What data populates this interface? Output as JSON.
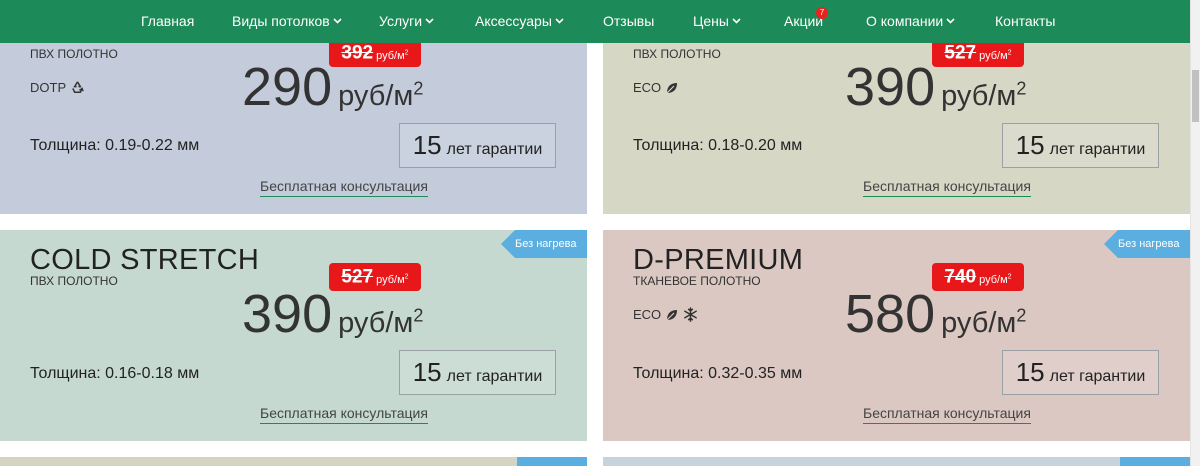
{
  "nav": {
    "items": [
      {
        "label": "Главная",
        "has_dropdown": false
      },
      {
        "label": "Виды потолков",
        "has_dropdown": true
      },
      {
        "label": "Услуги",
        "has_dropdown": true
      },
      {
        "label": "Аксессуары",
        "has_dropdown": true
      },
      {
        "label": "Отзывы",
        "has_dropdown": false
      },
      {
        "label": "Цены",
        "has_dropdown": true
      },
      {
        "label": "Акции",
        "has_dropdown": false,
        "badge": "7"
      },
      {
        "label": "О компании",
        "has_dropdown": true
      },
      {
        "label": "Контакты",
        "has_dropdown": false
      }
    ]
  },
  "colors": {
    "nav_bg": "#1d8a59",
    "accent": "#1d8a59",
    "sale_red": "#e8181a",
    "ribbon_blue": "#5aaee0",
    "card_blue_grey": "#c4ccdb",
    "card_beige": "#d7d7c6",
    "card_mint": "#c5d9d1",
    "card_rose": "#dbc8c2"
  },
  "common": {
    "unit": "руб/м",
    "unit_sup": "2",
    "warranty_number": "15",
    "warranty_text": "лет гарантии",
    "consult_label": "Бесплатная консультация",
    "ribbon_label": "Без нагрева"
  },
  "cards": [
    {
      "name": "",
      "material": "ПВХ полотно",
      "tech_label": "DOTP",
      "tech_icons": [
        "recycle-icon"
      ],
      "old_price": "392",
      "price": "290",
      "thickness": "Толщина: 0.19-0.22 мм",
      "has_ribbon": false
    },
    {
      "name": "",
      "material": "ПВХ полотно",
      "tech_label": "ECO",
      "tech_icons": [
        "leaf-icon"
      ],
      "old_price": "527",
      "price": "390",
      "thickness": "Толщина: 0.18-0.20 мм",
      "has_ribbon": false
    },
    {
      "name": "COLD STRETCH",
      "material": "ПВХ полотно",
      "tech_label": "",
      "tech_icons": [],
      "old_price": "527",
      "price": "390",
      "thickness": "Толщина: 0.16-0.18 мм",
      "has_ribbon": true
    },
    {
      "name": "D-PREMIUM",
      "material": "Тканевое полотно",
      "tech_label": "ECO",
      "tech_icons": [
        "leaf-icon",
        "snowflake-icon"
      ],
      "old_price": "740",
      "price": "580",
      "thickness": "Толщина: 0.32-0.35 мм",
      "has_ribbon": true
    }
  ]
}
